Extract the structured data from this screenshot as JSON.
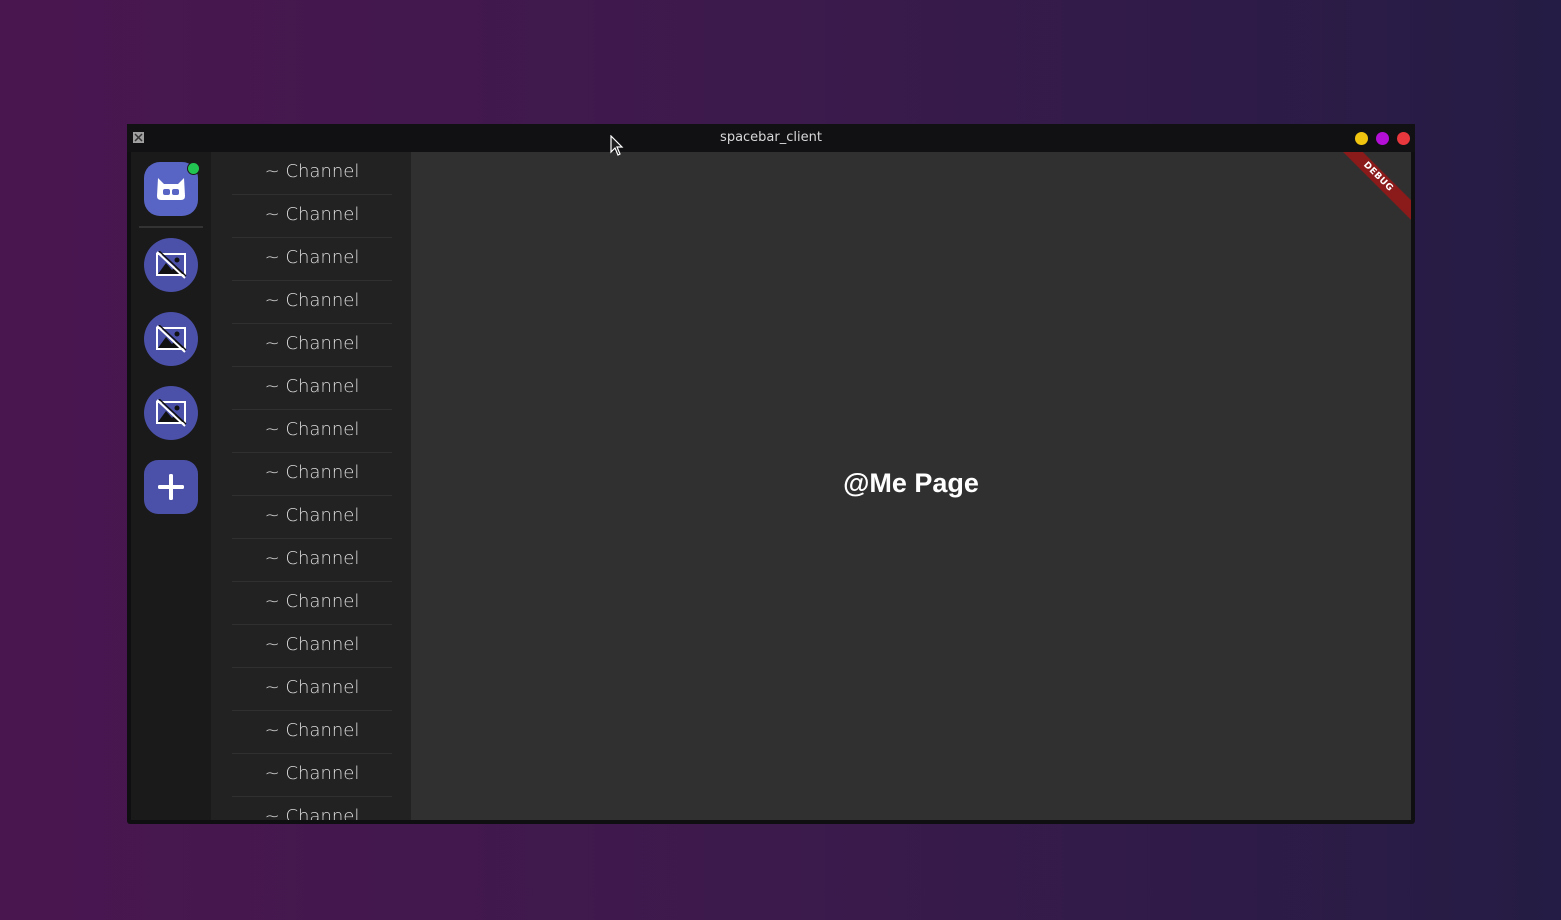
{
  "window": {
    "title": "spacebar_client",
    "controls": {
      "minimize_color": "#f1c40f",
      "maximize_color": "#b40fd6",
      "close_color": "#e8383d"
    }
  },
  "servers": {
    "home": {
      "icon": "discord-logo-icon",
      "status": "online",
      "status_color": "#23c552"
    },
    "guilds": [
      {
        "icon": "broken-image-icon"
      },
      {
        "icon": "broken-image-icon"
      },
      {
        "icon": "broken-image-icon"
      }
    ],
    "add": {
      "icon": "plus-icon"
    },
    "accent_color": "#4b50a8"
  },
  "channels": [
    {
      "label": "~ Channel"
    },
    {
      "label": "~ Channel"
    },
    {
      "label": "~ Channel"
    },
    {
      "label": "~ Channel"
    },
    {
      "label": "~ Channel"
    },
    {
      "label": "~ Channel"
    },
    {
      "label": "~ Channel"
    },
    {
      "label": "~ Channel"
    },
    {
      "label": "~ Channel"
    },
    {
      "label": "~ Channel"
    },
    {
      "label": "~ Channel"
    },
    {
      "label": "~ Channel"
    },
    {
      "label": "~ Channel"
    },
    {
      "label": "~ Channel"
    },
    {
      "label": "~ Channel"
    },
    {
      "label": "~ Channel"
    }
  ],
  "main": {
    "title": "@Me Page",
    "debug_banner": "DEBUG"
  }
}
